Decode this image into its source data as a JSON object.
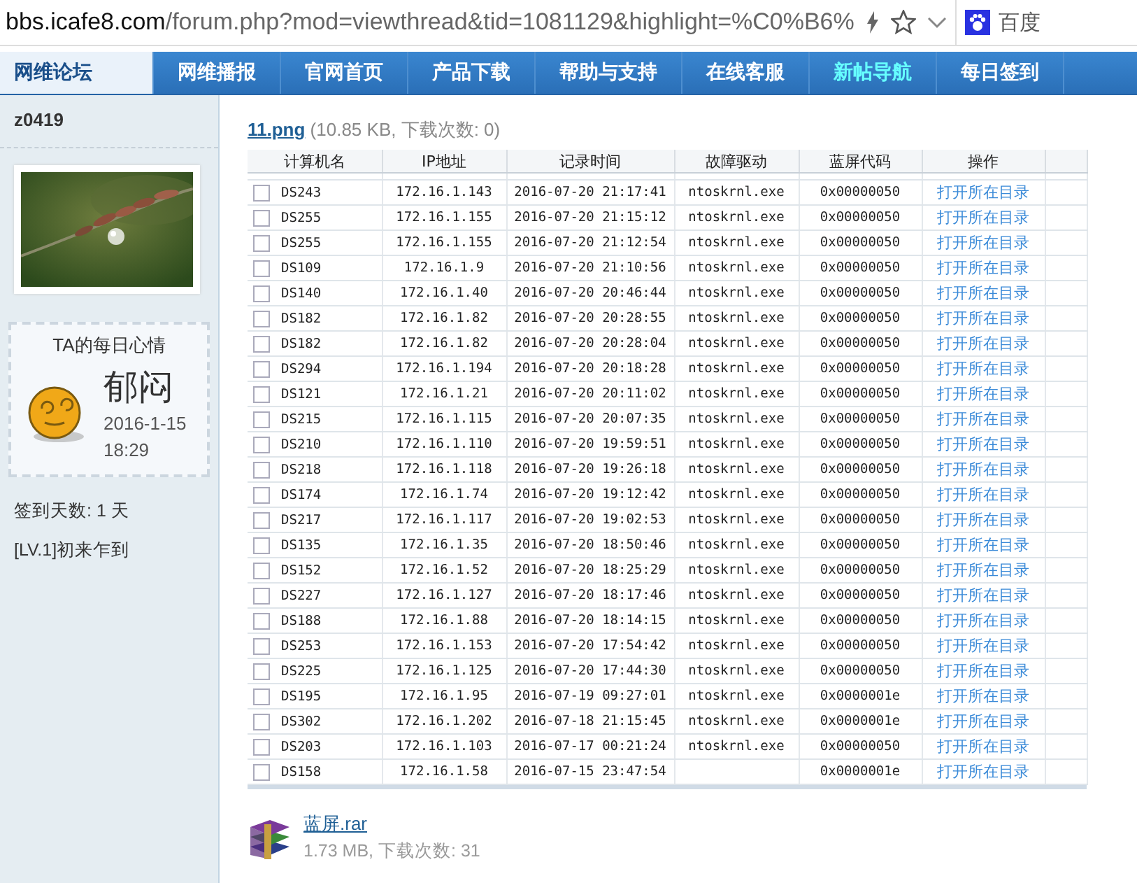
{
  "address_bar": {
    "host": "bbs.icafe8.com",
    "path": "/forum.php?mod=viewthread&tid=1081129&highlight=%C0%B6%",
    "search_engine": "百度"
  },
  "nav": [
    {
      "label": "网维论坛",
      "selected": true
    },
    {
      "label": "网维播报",
      "selected": false
    },
    {
      "label": "官网首页",
      "selected": false
    },
    {
      "label": "产品下载",
      "selected": false
    },
    {
      "label": "帮助与支持",
      "selected": false
    },
    {
      "label": "在线客服",
      "selected": false
    },
    {
      "label": "新帖导航",
      "selected": false,
      "highlight": true
    },
    {
      "label": "每日签到",
      "selected": false
    }
  ],
  "sidebar": {
    "username": "z0419",
    "mood_title": "TA的每日心情",
    "mood": "郁闷",
    "mood_date": "2016-1-15",
    "mood_time": "18:29",
    "checkin_days": "签到天数: 1 天",
    "level": "[LV.1]初来乍到"
  },
  "attachment": {
    "name": "11.png",
    "meta": "(10.85 KB, 下载次数: 0)"
  },
  "table": {
    "columns": [
      "计算机名",
      "IP地址",
      "记录时间",
      "故障驱动",
      "蓝屏代码",
      "操作"
    ],
    "rows": [
      {
        "checked": false,
        "name": "DS243",
        "ip": "172.16.1.143",
        "time": "2016-07-20 21:17:41",
        "driver": "ntoskrnl.exe",
        "code": "0x00000050",
        "action": "打开所在目录"
      },
      {
        "checked": false,
        "name": "DS255",
        "ip": "172.16.1.155",
        "time": "2016-07-20 21:15:12",
        "driver": "ntoskrnl.exe",
        "code": "0x00000050",
        "action": "打开所在目录"
      },
      {
        "checked": false,
        "name": "DS255",
        "ip": "172.16.1.155",
        "time": "2016-07-20 21:12:54",
        "driver": "ntoskrnl.exe",
        "code": "0x00000050",
        "action": "打开所在目录"
      },
      {
        "checked": false,
        "name": "DS109",
        "ip": "172.16.1.9",
        "time": "2016-07-20 21:10:56",
        "driver": "ntoskrnl.exe",
        "code": "0x00000050",
        "action": "打开所在目录"
      },
      {
        "checked": false,
        "name": "DS140",
        "ip": "172.16.1.40",
        "time": "2016-07-20 20:46:44",
        "driver": "ntoskrnl.exe",
        "code": "0x00000050",
        "action": "打开所在目录"
      },
      {
        "checked": false,
        "name": "DS182",
        "ip": "172.16.1.82",
        "time": "2016-07-20 20:28:55",
        "driver": "ntoskrnl.exe",
        "code": "0x00000050",
        "action": "打开所在目录"
      },
      {
        "checked": false,
        "name": "DS182",
        "ip": "172.16.1.82",
        "time": "2016-07-20 20:28:04",
        "driver": "ntoskrnl.exe",
        "code": "0x00000050",
        "action": "打开所在目录"
      },
      {
        "checked": false,
        "name": "DS294",
        "ip": "172.16.1.194",
        "time": "2016-07-20 20:18:28",
        "driver": "ntoskrnl.exe",
        "code": "0x00000050",
        "action": "打开所在目录"
      },
      {
        "checked": false,
        "name": "DS121",
        "ip": "172.16.1.21",
        "time": "2016-07-20 20:11:02",
        "driver": "ntoskrnl.exe",
        "code": "0x00000050",
        "action": "打开所在目录"
      },
      {
        "checked": false,
        "name": "DS215",
        "ip": "172.16.1.115",
        "time": "2016-07-20 20:07:35",
        "driver": "ntoskrnl.exe",
        "code": "0x00000050",
        "action": "打开所在目录"
      },
      {
        "checked": false,
        "name": "DS210",
        "ip": "172.16.1.110",
        "time": "2016-07-20 19:59:51",
        "driver": "ntoskrnl.exe",
        "code": "0x00000050",
        "action": "打开所在目录"
      },
      {
        "checked": false,
        "name": "DS218",
        "ip": "172.16.1.118",
        "time": "2016-07-20 19:26:18",
        "driver": "ntoskrnl.exe",
        "code": "0x00000050",
        "action": "打开所在目录"
      },
      {
        "checked": false,
        "name": "DS174",
        "ip": "172.16.1.74",
        "time": "2016-07-20 19:12:42",
        "driver": "ntoskrnl.exe",
        "code": "0x00000050",
        "action": "打开所在目录"
      },
      {
        "checked": false,
        "name": "DS217",
        "ip": "172.16.1.117",
        "time": "2016-07-20 19:02:53",
        "driver": "ntoskrnl.exe",
        "code": "0x00000050",
        "action": "打开所在目录"
      },
      {
        "checked": false,
        "name": "DS135",
        "ip": "172.16.1.35",
        "time": "2016-07-20 18:50:46",
        "driver": "ntoskrnl.exe",
        "code": "0x00000050",
        "action": "打开所在目录"
      },
      {
        "checked": false,
        "name": "DS152",
        "ip": "172.16.1.52",
        "time": "2016-07-20 18:25:29",
        "driver": "ntoskrnl.exe",
        "code": "0x00000050",
        "action": "打开所在目录"
      },
      {
        "checked": false,
        "name": "DS227",
        "ip": "172.16.1.127",
        "time": "2016-07-20 18:17:46",
        "driver": "ntoskrnl.exe",
        "code": "0x00000050",
        "action": "打开所在目录"
      },
      {
        "checked": false,
        "name": "DS188",
        "ip": "172.16.1.88",
        "time": "2016-07-20 18:14:15",
        "driver": "ntoskrnl.exe",
        "code": "0x00000050",
        "action": "打开所在目录"
      },
      {
        "checked": false,
        "name": "DS253",
        "ip": "172.16.1.153",
        "time": "2016-07-20 17:54:42",
        "driver": "ntoskrnl.exe",
        "code": "0x00000050",
        "action": "打开所在目录"
      },
      {
        "checked": false,
        "name": "DS225",
        "ip": "172.16.1.125",
        "time": "2016-07-20 17:44:30",
        "driver": "ntoskrnl.exe",
        "code": "0x00000050",
        "action": "打开所在目录"
      },
      {
        "checked": false,
        "name": "DS195",
        "ip": "172.16.1.95",
        "time": "2016-07-19 09:27:01",
        "driver": "ntoskrnl.exe",
        "code": "0x0000001e",
        "action": "打开所在目录"
      },
      {
        "checked": false,
        "name": "DS302",
        "ip": "172.16.1.202",
        "time": "2016-07-18 21:15:45",
        "driver": "ntoskrnl.exe",
        "code": "0x0000001e",
        "action": "打开所在目录"
      },
      {
        "checked": false,
        "name": "DS203",
        "ip": "172.16.1.103",
        "time": "2016-07-17 00:21:24",
        "driver": "ntoskrnl.exe",
        "code": "0x00000050",
        "action": "打开所在目录"
      },
      {
        "checked": false,
        "name": "DS158",
        "ip": "172.16.1.58",
        "time": "2016-07-15 23:47:54",
        "code": "0x0000001e",
        "action": "打开所在目录"
      }
    ]
  },
  "file": {
    "name": "蓝屏.rar",
    "meta": "1.73 MB, 下载次数: 31"
  }
}
